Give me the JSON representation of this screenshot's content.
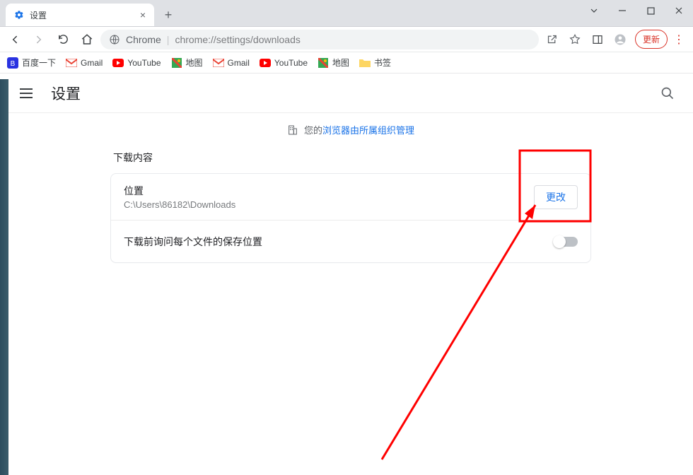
{
  "tab": {
    "title": "设置"
  },
  "address": {
    "host": "Chrome",
    "url": "chrome://settings/downloads"
  },
  "toolbar": {
    "update_label": "更新"
  },
  "bookmarks": [
    "百度一下",
    "Gmail",
    "YouTube",
    "地图",
    "Gmail",
    "YouTube",
    "地图",
    "书签"
  ],
  "settings": {
    "app_title": "设置",
    "managed_prefix": "您的",
    "managed_link": "浏览器由所属组织管理",
    "section_title": "下载内容",
    "location": {
      "label": "位置",
      "path": "C:\\Users\\86182\\Downloads",
      "change_btn": "更改"
    },
    "ask_save": {
      "label": "下载前询问每个文件的保存位置",
      "enabled": false
    }
  }
}
